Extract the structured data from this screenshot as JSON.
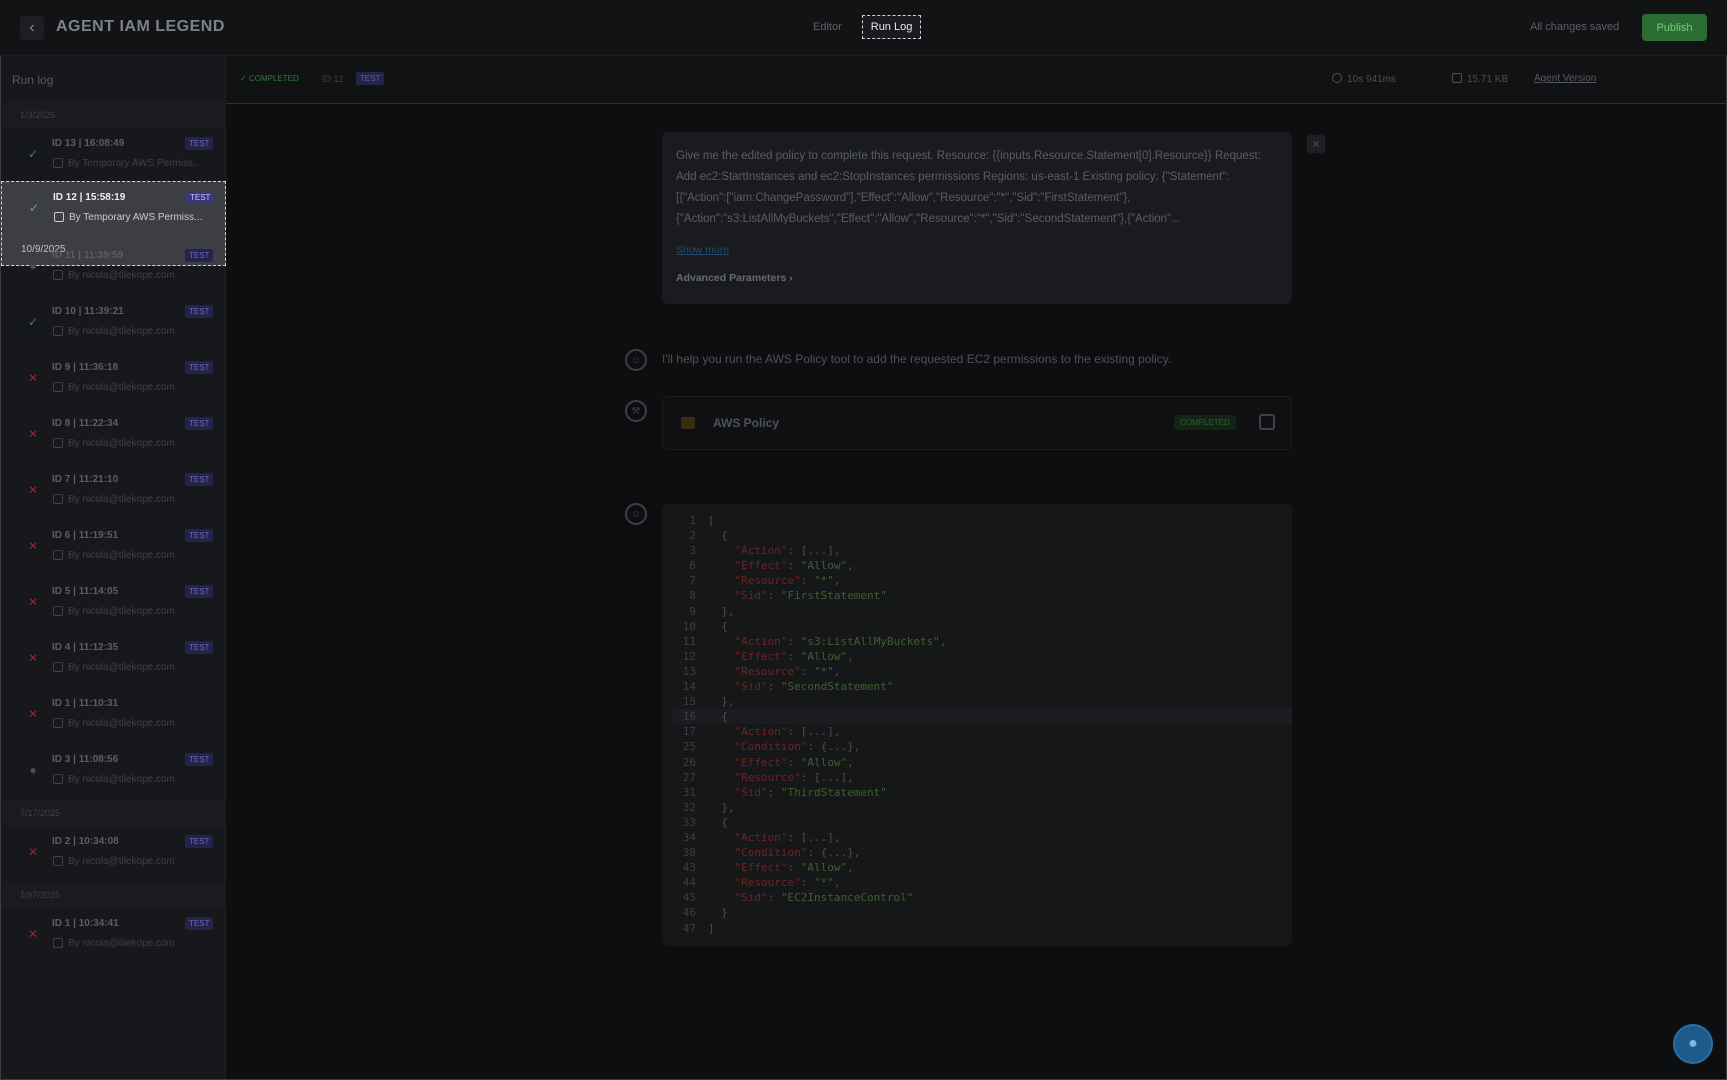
{
  "header": {
    "agent_title": "AGENT IAM LEGEND",
    "tabs": [
      {
        "label": "Editor",
        "active": false
      },
      {
        "label": "Run Log",
        "active": true
      }
    ],
    "save_status": "All changes saved",
    "publish_label": "Publish"
  },
  "sidebar": {
    "title": "Run log",
    "groups": [
      {
        "date": "1/3/2026",
        "items": [
          {
            "id_time": "ID 13 | 16:08:49",
            "by": "By Temporary AWS Permiss...",
            "status": "success",
            "badge": "TEST"
          },
          {
            "id_time": "ID 12 | 15:58:19",
            "by": "By Temporary AWS Permiss...",
            "status": "success",
            "badge": "TEST",
            "selected": true,
            "date": "10/9/2025"
          },
          {
            "id_time": "ID 11 | 11:39:59",
            "by": "By nicola@tilekope.com",
            "status": "pending",
            "badge": "TEST"
          },
          {
            "id_time": "ID 10 | 11:39:21",
            "by": "By nicola@tilekope.com",
            "status": "success",
            "badge": "TEST"
          },
          {
            "id_time": "ID 9 | 11:36:18",
            "by": "By nicola@tilekope.com",
            "status": "failed",
            "badge": "TEST"
          },
          {
            "id_time": "ID 8 | 11:22:34",
            "by": "By nicola@tilekope.com",
            "status": "failed",
            "badge": "TEST"
          },
          {
            "id_time": "ID 7 | 11:21:10",
            "by": "By nicola@tilekope.com",
            "status": "failed",
            "badge": "TEST"
          },
          {
            "id_time": "ID 6 | 11:19:51",
            "by": "By nicola@tilekope.com",
            "status": "failed",
            "badge": "TEST"
          },
          {
            "id_time": "ID 5 | 11:14:05",
            "by": "By nicola@tilekope.com",
            "status": "failed",
            "badge": "TEST"
          },
          {
            "id_time": "ID 4 | 11:12:35",
            "by": "By nicola@tilekope.com",
            "status": "failed",
            "badge": "TEST"
          },
          {
            "id_time": "ID 1 | 11:10:31",
            "by": "By nicola@tilekope.com",
            "status": "failed",
            "badge": ""
          },
          {
            "id_time": "ID 3 | 11:08:56",
            "by": "By nicola@tilekope.com",
            "status": "pending",
            "badge": "TEST"
          }
        ]
      },
      {
        "date": "7/17/2025",
        "items": [
          {
            "id_time": "ID 2 | 10:34:08",
            "by": "By nicola@tilekope.com",
            "status": "failed",
            "badge": "TEST"
          }
        ]
      },
      {
        "date": "10/7/2025",
        "items": [
          {
            "id_time": "ID 1 | 10:34:41",
            "by": "By nicola@tilekope.com",
            "status": "failed",
            "badge": "TEST"
          }
        ]
      }
    ]
  },
  "subheader": {
    "status": "COMPLETED",
    "id": "ID 12",
    "badge": "TEST",
    "duration": "10s 941ms",
    "size": "15.71 KB",
    "version_link": "Agent Version"
  },
  "prompt": {
    "text": "Give me the edited policy to complete this request. Resource: {{inputs.Resource.Statement[0].Resource}} Request: Add ec2:StartInstances and ec2:StopInstances permissions Regions: us-east-1 Existing policy: {\"Statement\":[{\"Action\":[\"iam:ChangePassword\"],\"Effect\":\"Allow\",\"Resource\":\"*\",\"Sid\":\"FirstStatement\"},{\"Action\":\"s3:ListAllMyBuckets\",\"Effect\":\"Allow\",\"Resource\":\"*\",\"Sid\":\"SecondStatement\"},{\"Action\"...",
    "show_more": "Show more",
    "advanced": "Advanced Parameters"
  },
  "assistant_message": "I'll help you run the AWS Policy tool to add the requested EC2 permissions to the existing policy.",
  "tool": {
    "name": "AWS Policy",
    "status": "COMPLETED"
  },
  "code_lines": [
    {
      "n": "1",
      "t": "[",
      "fold": true
    },
    {
      "n": "2",
      "t": "  {",
      "fold": true
    },
    {
      "n": "3",
      "k": "    \"Action\"",
      "r": ": [...],",
      "fold": true
    },
    {
      "n": "6",
      "k": "    \"Effect\"",
      "r": ": ",
      "s": "\"Allow\"",
      "e": ","
    },
    {
      "n": "7",
      "k": "    \"Resource\"",
      "r": ": ",
      "s": "\"*\"",
      "e": ","
    },
    {
      "n": "8",
      "k": "    \"Sid\"",
      "r": ": ",
      "s": "\"FirstStatement\"",
      "e": ""
    },
    {
      "n": "9",
      "t": "  },"
    },
    {
      "n": "10",
      "t": "  {",
      "fold": true
    },
    {
      "n": "11",
      "k": "    \"Action\"",
      "r": ": ",
      "s": "\"s3:ListAllMyBuckets\"",
      "e": ","
    },
    {
      "n": "12",
      "k": "    \"Effect\"",
      "r": ": ",
      "s": "\"Allow\"",
      "e": ","
    },
    {
      "n": "13",
      "k": "    \"Resource\"",
      "r": ": ",
      "s": "\"*\"",
      "e": ","
    },
    {
      "n": "14",
      "k": "    \"Sid\"",
      "r": ": ",
      "s": "\"SecondStatement\"",
      "e": ""
    },
    {
      "n": "15",
      "t": "  },"
    },
    {
      "n": "16",
      "t": "  {",
      "fold": true,
      "hl": true
    },
    {
      "n": "17",
      "k": "    \"Action\"",
      "r": ": [...],",
      "fold": true
    },
    {
      "n": "25",
      "k": "    \"Condition\"",
      "r": ": {...},",
      "fold": true
    },
    {
      "n": "26",
      "k": "    \"Effect\"",
      "r": ": ",
      "s": "\"Allow\"",
      "e": ","
    },
    {
      "n": "27",
      "k": "    \"Resource\"",
      "r": ": [...],",
      "fold": true
    },
    {
      "n": "31",
      "k": "    \"Sid\"",
      "r": ": ",
      "s": "\"ThirdStatement\"",
      "e": ""
    },
    {
      "n": "32",
      "t": "  },"
    },
    {
      "n": "33",
      "t": "  {",
      "fold": true
    },
    {
      "n": "34",
      "k": "    \"Action\"",
      "r": ": [...],",
      "fold": true
    },
    {
      "n": "38",
      "k": "    \"Condition\"",
      "r": ": {...},",
      "fold": true
    },
    {
      "n": "43",
      "k": "    \"Effect\"",
      "r": ": ",
      "s": "\"Allow\"",
      "e": ","
    },
    {
      "n": "44",
      "k": "    \"Resource\"",
      "r": ": ",
      "s": "\"*\"",
      "e": ","
    },
    {
      "n": "45",
      "k": "    \"Sid\"",
      "r": ": ",
      "s": "\"EC2InstanceControl\"",
      "e": ""
    },
    {
      "n": "46",
      "t": "  }"
    },
    {
      "n": "47",
      "t": "]"
    }
  ]
}
